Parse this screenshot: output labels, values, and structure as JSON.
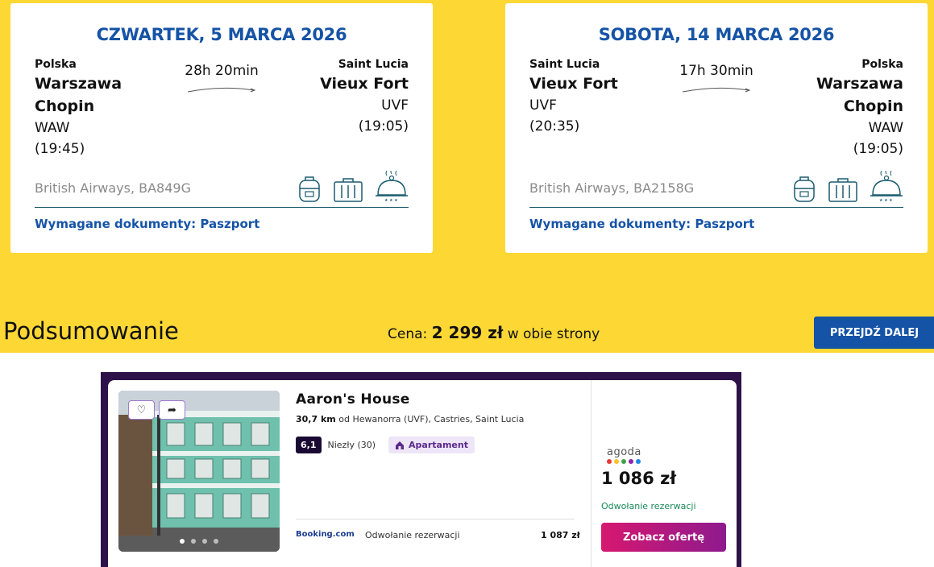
{
  "outbound": {
    "date": "CZWARTEK, 5 MARCA 2026",
    "from": {
      "country": "Polska",
      "city": "Warszawa Chopin",
      "code": "WAW",
      "time": "(19:45)"
    },
    "to": {
      "country": "Saint Lucia",
      "city": "Vieux Fort",
      "code": "UVF",
      "time": "(19:05)"
    },
    "duration": "28h 20min",
    "airline": "British Airways, BA849G",
    "documents": "Wymagane dokumenty: Paszport"
  },
  "inbound": {
    "date": "SOBOTA, 14 MARCA 2026",
    "from": {
      "country": "Saint Lucia",
      "city": "Vieux Fort",
      "code": "UVF",
      "time": "(20:35)"
    },
    "to": {
      "country": "Polska",
      "city": "Warszawa Chopin",
      "code": "WAW",
      "time": "(19:05)"
    },
    "duration": "17h 30min",
    "airline": "British Airways, BA2158G",
    "documents": "Wymagane dokumenty: Paszport"
  },
  "icons": [
    "backpack-icon",
    "suitcase-icon",
    "meal-icon"
  ],
  "summary": {
    "title": "Podsumowanie",
    "price_label": "Cena:",
    "price_value": "2 299 zł",
    "price_suffix": "w obie strony",
    "next_button": "PRZEJDŹ DALEJ"
  },
  "hotel": {
    "name": "Aaron's House",
    "distance": "30,7 km",
    "distance_rest": "od Hewanorra (UVF), Castries, Saint Lucia",
    "score": "6,1",
    "rating_text": "Niezły (30)",
    "type": "Apartament",
    "booking_logo": "Booking.com",
    "booking_cancel": "Odwołanie rezerwacji",
    "booking_price": "1 087 zł",
    "agoda_logo": "agoda",
    "agoda_price": "1 086 zł",
    "agoda_cancel": "Odwołanie rezerwacji",
    "offer_button": "Zobacz ofertę",
    "colors": {
      "accent": "#d6186f",
      "frame": "#2c1248"
    }
  },
  "colors": {
    "brand_yellow": "#fdd835",
    "brand_blue": "#1553a6"
  }
}
